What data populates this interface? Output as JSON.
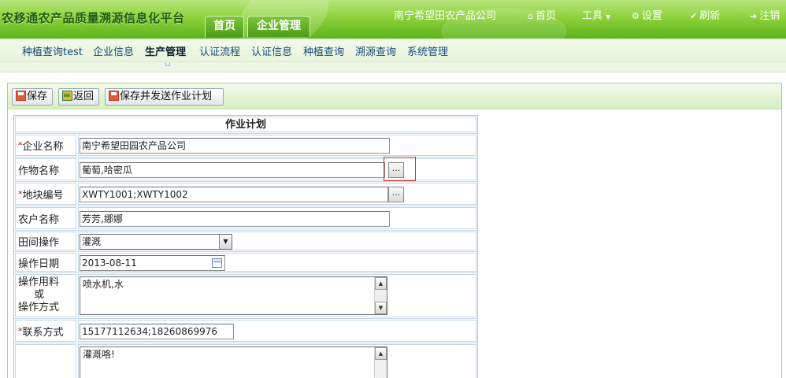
{
  "header": {
    "app_title": "农移通农产品质量溯源信息化平台",
    "tabs": [
      {
        "label": "首页"
      },
      {
        "label": "企业管理"
      }
    ],
    "company": "南宁希望田农产品公司",
    "links": {
      "home": "首页",
      "tools": "工具",
      "settings": "设置",
      "refresh": "刷新",
      "logout": "注销"
    }
  },
  "subnav": {
    "items": [
      "种植查询test",
      "企业信息",
      "生产管理",
      "认证流程",
      "认证信息",
      "种植查询",
      "溯源查询",
      "系统管理"
    ],
    "active": "生产管理"
  },
  "toolbar": {
    "save": "保存",
    "back": "返回",
    "save_send": "保存并发送作业计划"
  },
  "form": {
    "caption": "作业计划",
    "enterprise": {
      "label": "企业名称",
      "value": "南宁希望田园农产品公司"
    },
    "crop": {
      "label": "作物名称",
      "value": "葡萄,哈密瓜",
      "button": "..."
    },
    "plot": {
      "label": "地块编号",
      "value": "XWTY1001;XWTY1002",
      "button": "..."
    },
    "farmer": {
      "label": "农户名称",
      "value": "芳芳,娜娜"
    },
    "operation": {
      "label": "田间操作",
      "value": "灌溉"
    },
    "date": {
      "label": "操作日期",
      "value": "2013-08-11"
    },
    "material": {
      "label_line1": "操作用料",
      "label_line2": "或",
      "label_line3": "操作方式",
      "value": "喷水机,水"
    },
    "contact": {
      "label": "联系方式",
      "value": "15177112634;18260869976"
    },
    "remark": {
      "value": "灌溉咯!"
    }
  }
}
